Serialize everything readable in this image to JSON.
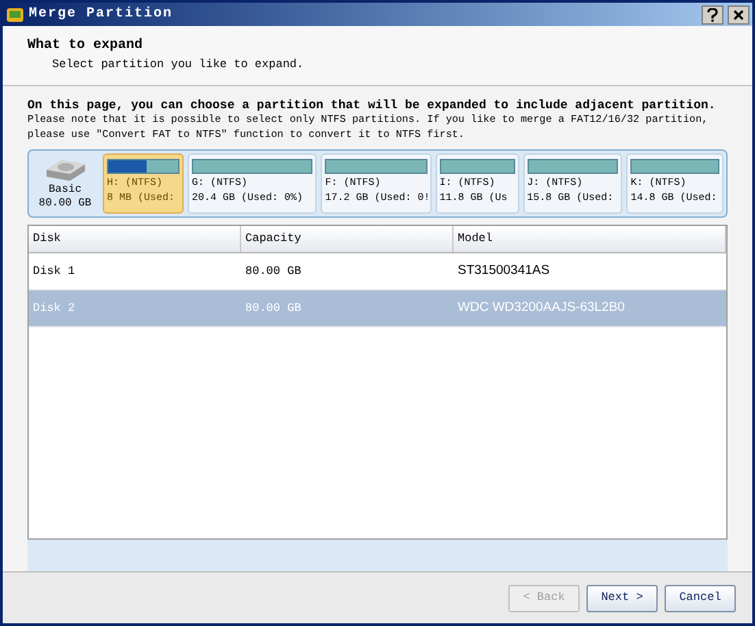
{
  "window": {
    "title": "Merge Partition"
  },
  "header": {
    "title": "What to expand",
    "subtitle": "Select partition you like to expand."
  },
  "intro": {
    "heading": "On this page, you can choose a partition that will be expanded to include adjacent partition.",
    "note": "Please note that it is possible to select only NTFS partitions. If you like to merge a FAT12/16/32 partition, please use \"Convert FAT to NTFS\" function to convert it to NTFS first."
  },
  "disk_map": {
    "disk": {
      "type": "Basic",
      "size": "80.00 GB"
    },
    "partitions": [
      {
        "name": "H: (NTFS)",
        "info": "8 MB (Used:",
        "selected": true,
        "level": 0.55
      },
      {
        "name": "G: (NTFS)",
        "info": "20.4 GB (Used: 0%)",
        "selected": false
      },
      {
        "name": "F: (NTFS)",
        "info": "17.2 GB (Used: 0!",
        "selected": false
      },
      {
        "name": "I: (NTFS)",
        "info": "11.8 GB (Us",
        "selected": false
      },
      {
        "name": "J: (NTFS)",
        "info": "15.8 GB (Used:",
        "selected": false
      },
      {
        "name": "K: (NTFS)",
        "info": "14.8 GB (Used:",
        "selected": false
      }
    ]
  },
  "table": {
    "columns": [
      "Disk",
      "Capacity",
      "Model"
    ],
    "rows": [
      {
        "cells": [
          "Disk 1",
          "80.00 GB",
          "ST31500341AS"
        ],
        "selected": false
      },
      {
        "cells": [
          "Disk 2",
          "80.00 GB",
          "WDC WD3200AAJS-63L2B0"
        ],
        "selected": true
      }
    ]
  },
  "buttons": [
    {
      "label": "< Back",
      "disabled": true
    },
    {
      "label": "Next >",
      "disabled": false
    },
    {
      "label": "Cancel",
      "disabled": false
    }
  ]
}
